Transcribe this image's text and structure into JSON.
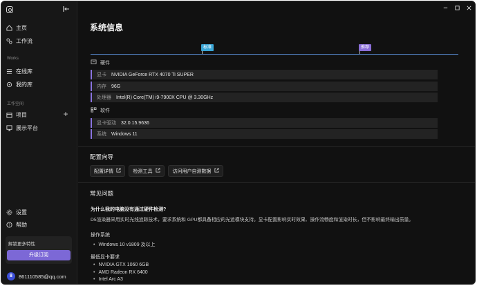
{
  "sidebar": {
    "nav": [
      {
        "label": "主页",
        "icon": "home-icon"
      },
      {
        "label": "工作流",
        "icon": "workflow-icon"
      }
    ],
    "works_label": "Works",
    "works": [
      {
        "label": "在线库",
        "icon": "online-library-icon"
      },
      {
        "label": "我的库",
        "icon": "my-library-icon"
      }
    ],
    "workspace_label": "工作空间",
    "workspace": [
      {
        "label": "项目",
        "icon": "project-icon"
      },
      {
        "label": "展示平台",
        "icon": "showcase-icon"
      }
    ],
    "bottom": [
      {
        "label": "设置",
        "icon": "gear-icon"
      },
      {
        "label": "帮助",
        "icon": "help-icon"
      }
    ],
    "promo_text": "解锁更多特性",
    "upgrade_label": "升级订阅",
    "user_initial": "8",
    "user_email": "861110585@qq.com"
  },
  "main": {
    "title": "系统信息",
    "markers": [
      {
        "label": "标准",
        "color": "#3aa6d6"
      },
      {
        "label": "推荐",
        "color": "#8b6fd8"
      }
    ],
    "hardware_label": "硬件",
    "hardware": [
      {
        "label": "显卡",
        "value": "NVIDIA GeForce RTX 4070 Ti SUPER"
      },
      {
        "label": "内存",
        "value": "96G"
      },
      {
        "label": "处理器",
        "value": "Intel(R) Core(TM) i9-7900X CPU @ 3.30GHz"
      }
    ],
    "software_label": "软件",
    "software": [
      {
        "label": "显卡驱动",
        "value": "32.0.15.9636"
      },
      {
        "label": "系统",
        "value": "Windows 11"
      }
    ],
    "guide_title": "配置向导",
    "guide_links": [
      {
        "label": "配置详情"
      },
      {
        "label": "检测工具"
      },
      {
        "label": "访问用户自测数据"
      }
    ],
    "faq_title": "常见问题",
    "faq_question": "为什么我的电脑没有通过硬件检测?",
    "faq_answer": "D5渲染器采用实时光线追踪技术，要求系统和 GPU都具备相应的光追模块支持。显卡配置影响实时效果、操作流畅度和渲染时长，但不影响最终输出质量。",
    "os_title": "操作系统",
    "os_items": [
      "Windows 10 v1809 及以上"
    ],
    "gpu_title": "最低显卡要求",
    "gpu_items": [
      "NVIDIA GTX 1060 6GB",
      "AMD Radeon RX 6400",
      "Intel Arc A3"
    ]
  },
  "colors": {
    "accent": "#7c68d6",
    "track": "#5a8fd8",
    "background": "#111111"
  }
}
